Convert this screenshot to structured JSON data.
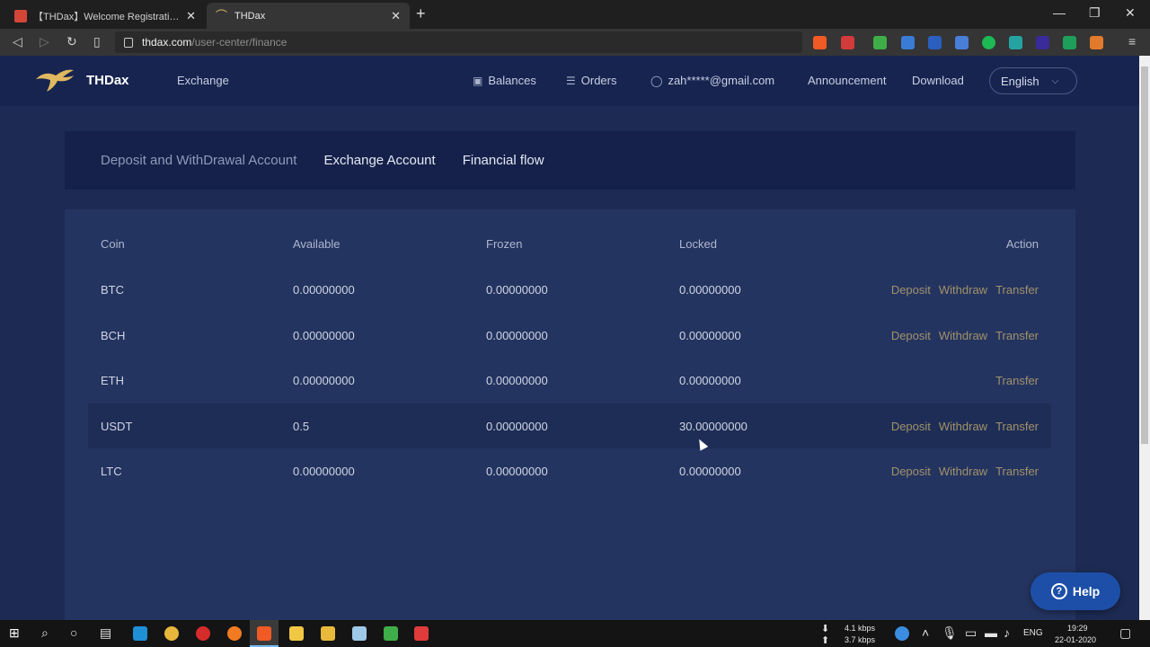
{
  "browser": {
    "tabs": [
      {
        "title": "【THDax】Welcome Registration - z",
        "active": false
      },
      {
        "title": "THDax",
        "active": true
      }
    ],
    "new_tab": "+",
    "url_host": "thdax.com",
    "url_path": "/user-center/finance"
  },
  "topnav": {
    "brand": "THDax",
    "exchange": "Exchange",
    "balances": "Balances",
    "orders": "Orders",
    "account": "zah*****@gmail.com",
    "announcement": "Announcement",
    "download": "Download",
    "language": "English"
  },
  "account_tabs": [
    {
      "label": "Deposit and WithDrawal Account",
      "active": false
    },
    {
      "label": "Exchange Account",
      "active": true
    },
    {
      "label": "Financial flow",
      "active": true
    }
  ],
  "table": {
    "headers": {
      "coin": "Coin",
      "available": "Available",
      "frozen": "Frozen",
      "locked": "Locked",
      "action": "Action"
    },
    "rows": [
      {
        "coin": "BTC",
        "available": "0.00000000",
        "frozen": "0.00000000",
        "locked": "0.00000000",
        "actions": [
          "Deposit",
          "Withdraw",
          "Transfer"
        ]
      },
      {
        "coin": "BCH",
        "available": "0.00000000",
        "frozen": "0.00000000",
        "locked": "0.00000000",
        "actions": [
          "Deposit",
          "Withdraw",
          "Transfer"
        ]
      },
      {
        "coin": "ETH",
        "available": "0.00000000",
        "frozen": "0.00000000",
        "locked": "0.00000000",
        "actions": [
          "Transfer"
        ]
      },
      {
        "coin": "USDT",
        "available": "0.5",
        "frozen": "0.00000000",
        "locked": "30.00000000",
        "actions": [
          "Deposit",
          "Withdraw",
          "Transfer"
        ]
      },
      {
        "coin": "LTC",
        "available": "0.00000000",
        "frozen": "0.00000000",
        "locked": "0.00000000",
        "actions": [
          "Deposit",
          "Withdraw",
          "Transfer"
        ]
      }
    ],
    "highlighted_coin": "USDT"
  },
  "help_label": "Help",
  "taskbar": {
    "net_down": "4.1 kbps",
    "net_up": "3.7 kbps",
    "lang": "ENG",
    "time": "19:29",
    "date": "22-01-2020"
  },
  "colors": {
    "page_bg": "#1d2b54",
    "nav_bg": "#172450",
    "card_bg": "#243460",
    "action_text": "#a1926a",
    "help_bg": "#1d4fa8"
  }
}
